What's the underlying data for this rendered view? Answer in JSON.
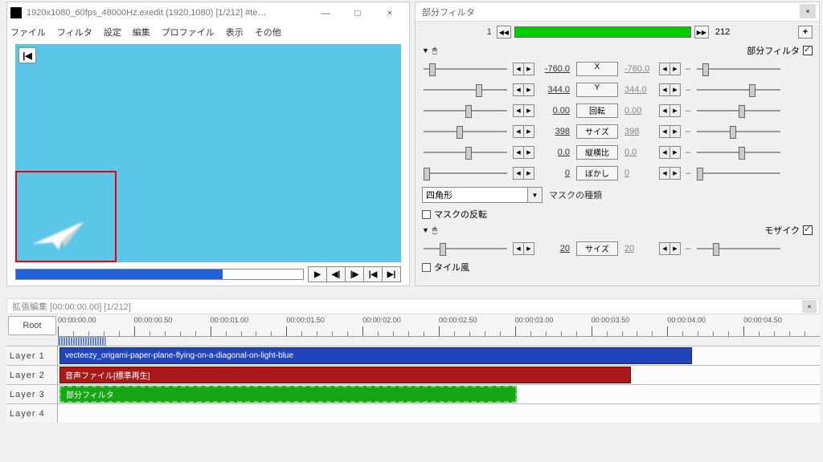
{
  "preview": {
    "title": "1920x1080_60fps_48000Hz.exedit (1920,1080) [1/212] #te…",
    "menu": [
      "ファイル",
      "フィルタ",
      "設定",
      "編集",
      "プロファイル",
      "表示",
      "その他"
    ],
    "win": {
      "min": "—",
      "max": "□",
      "close": "×"
    },
    "start_icon": "|◀"
  },
  "play": {
    "play": "▶",
    "step_back": "◀|",
    "step_fwd": "|▶",
    "first": "|◀",
    "last": "▶|"
  },
  "filter": {
    "title": "部分フィルタ",
    "current_frame": "1",
    "total_frames": "212",
    "section1": "部分フィルタ",
    "section2": "モザイク",
    "params": [
      {
        "v1": "-760.0",
        "label": "X",
        "v2": "-760.0"
      },
      {
        "v1": "344.0",
        "label": "Y",
        "v2": "344.0"
      },
      {
        "v1": "0.00",
        "label": "回転",
        "v2": "0.00"
      },
      {
        "v1": "398",
        "label": "サイズ",
        "v2": "398"
      },
      {
        "v1": "0.0",
        "label": "縦横比",
        "v2": "0.0"
      },
      {
        "v1": "0",
        "label": "ぼかし",
        "v2": "0"
      }
    ],
    "mask_type_value": "四角形",
    "mask_type_label": "マスクの種類",
    "invert": "マスクの反転",
    "mosaic_size": {
      "v1": "20",
      "label": "サイズ",
      "v2": "20"
    },
    "tile": "タイル風"
  },
  "timeline": {
    "title": "拡張編集 [00:00:00.00] [1/212]",
    "root": "Root",
    "times": [
      "00:00:00.00",
      "00:00:00.50",
      "00:00:01.00",
      "00:00:01.50",
      "00:00:02.00",
      "00:00:02.50",
      "00:00:03.00",
      "00:00:03.50",
      "00:00:04.00",
      "00:00:04.50"
    ],
    "layers": [
      "Layer 1",
      "Layer 2",
      "Layer 3",
      "Layer 4"
    ],
    "clips": {
      "video": "vecteezy_origami-paper-plane-flying-on-a-diagonal-on-light-blue",
      "audio": "音声ファイル[標準再生]",
      "filter": "部分フィルタ"
    }
  }
}
